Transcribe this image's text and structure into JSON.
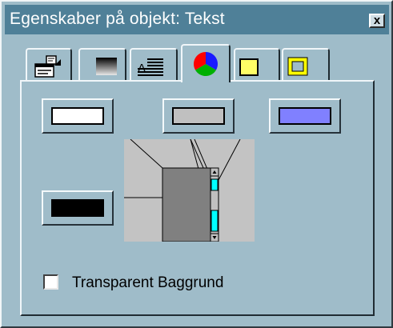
{
  "window": {
    "title": "Egenskaber på objekt: Tekst",
    "close_label": "x"
  },
  "tabs": [
    {
      "name": "properties",
      "icon": "properties-icon",
      "active": false
    },
    {
      "name": "gradient",
      "icon": "gradient-icon",
      "active": false
    },
    {
      "name": "text-align",
      "icon": "text-align-icon",
      "active": false
    },
    {
      "name": "colors",
      "icon": "color-wheel-icon",
      "active": true
    },
    {
      "name": "fill",
      "icon": "yellow-fill-icon",
      "active": false
    },
    {
      "name": "border",
      "icon": "yellow-border-icon",
      "active": false
    }
  ],
  "swatches": [
    {
      "name": "white",
      "color": "#ffffff"
    },
    {
      "name": "gray",
      "color": "#c0c0c0"
    },
    {
      "name": "blue",
      "color": "#8080ff"
    },
    {
      "name": "black",
      "color": "#000000"
    }
  ],
  "preview": {
    "background": "#c3c3c3",
    "object_color": "#808080",
    "scrollbar_color": "#00ffff"
  },
  "transparent_checkbox": {
    "label": "Transparent Baggrund",
    "checked": false
  }
}
